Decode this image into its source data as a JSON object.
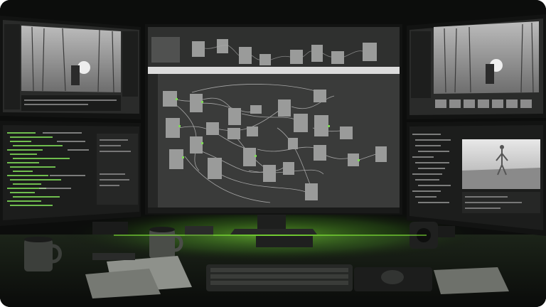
{
  "scene": {
    "description_free": true,
    "accent_color": "#7ed957",
    "background_color": "#0c0d0c",
    "monitor_bezel_color": "#121312",
    "node_panel_color": "#3a3b3a",
    "node_color": "#9a9b9a",
    "light_color": "#8dff3a"
  },
  "monitors": [
    {
      "id": "top-left",
      "content": "video-viewer"
    },
    {
      "id": "bottom-left",
      "content": "code-editor"
    },
    {
      "id": "center",
      "content": "node-graph"
    },
    {
      "id": "top-right",
      "content": "video-viewer"
    },
    {
      "id": "bottom-right",
      "content": "3d-viewport"
    }
  ],
  "desk_items": [
    "mug-left",
    "mug-center",
    "keyboard",
    "mouse",
    "papers",
    "speaker"
  ]
}
